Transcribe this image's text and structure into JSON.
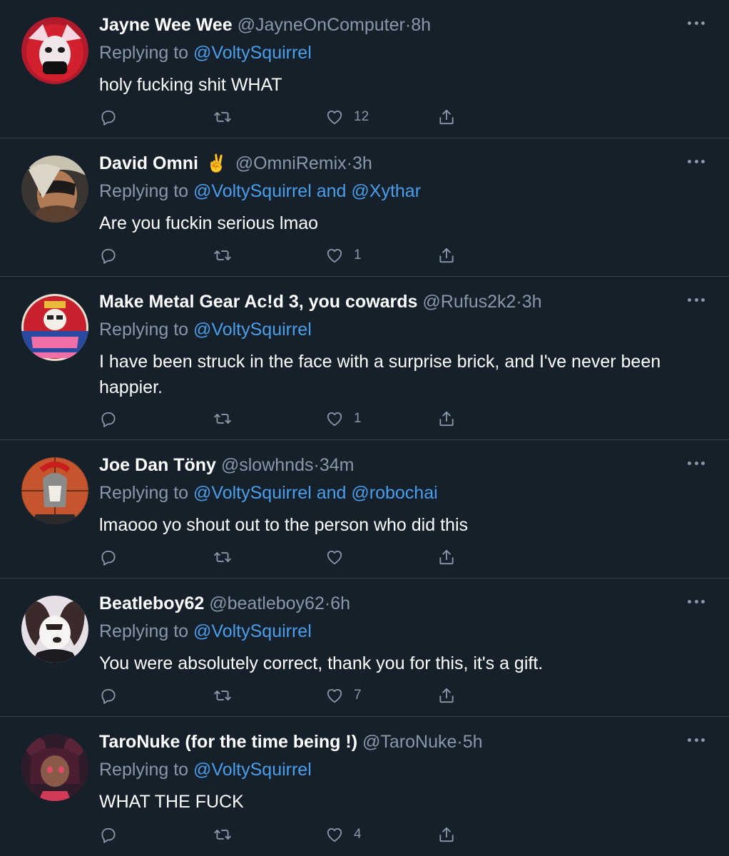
{
  "colors": {
    "background": "#15202b",
    "divider": "#38444d",
    "secondary_text": "#8899a6",
    "link": "#4a9eea"
  },
  "replying_to_label": "Replying to",
  "replies": [
    {
      "display_name": "Jayne Wee Wee",
      "emoji": "",
      "handle": "@JayneOnComputer",
      "dot": "·",
      "time": "8h",
      "mention_1": "@VoltySquirrel",
      "and_label": "",
      "mention_2": "",
      "text": "holy fucking shit WHAT",
      "like_count": "12",
      "avatar_icon": "red-jester-avatar"
    },
    {
      "display_name": "David Omni",
      "emoji": "✌️",
      "handle": "@OmniRemix",
      "dot": "·",
      "time": "3h",
      "mention_1": "@VoltySquirrel",
      "and_label": "and",
      "mention_2": "@Xythar",
      "text": "Are you fuckin serious lmao",
      "like_count": "1",
      "avatar_icon": "masked-hero-avatar"
    },
    {
      "display_name": "Make Metal Gear Ac!d 3, you cowards",
      "emoji": "",
      "handle": "@Rufus2k2",
      "dot": "·",
      "time": "3h",
      "mention_1": "@VoltySquirrel",
      "and_label": "",
      "mention_2": "",
      "text": "I have been struck in the face with a surprise brick, and I've never been happier.",
      "like_count": "1",
      "avatar_icon": "skull-logo-avatar"
    },
    {
      "display_name": "Joe Dan Töny",
      "emoji": "",
      "handle": "@slowhnds",
      "dot": "·",
      "time": "34m",
      "mention_1": "@VoltySquirrel",
      "and_label": "and",
      "mention_2": "@robochai",
      "text": "lmaooo yo shout out to the person who did this",
      "like_count": "",
      "avatar_icon": "spartan-avatar"
    },
    {
      "display_name": "Beatleboy62",
      "emoji": "",
      "handle": "@beatleboy62",
      "dot": "·",
      "time": "6h",
      "mention_1": "@VoltySquirrel",
      "and_label": "",
      "mention_2": "",
      "text": "You were absolutely correct, thank you for this, it's a gift.",
      "like_count": "7",
      "avatar_icon": "dog-character-avatar"
    },
    {
      "display_name": "TaroNuke (for the time being !)",
      "emoji": "",
      "handle": "@TaroNuke",
      "dot": "·",
      "time": "5h",
      "mention_1": "@VoltySquirrel",
      "and_label": "",
      "mention_2": "",
      "text": "WHAT THE FUCK",
      "like_count": "4",
      "avatar_icon": "anime-character-avatar"
    }
  ]
}
